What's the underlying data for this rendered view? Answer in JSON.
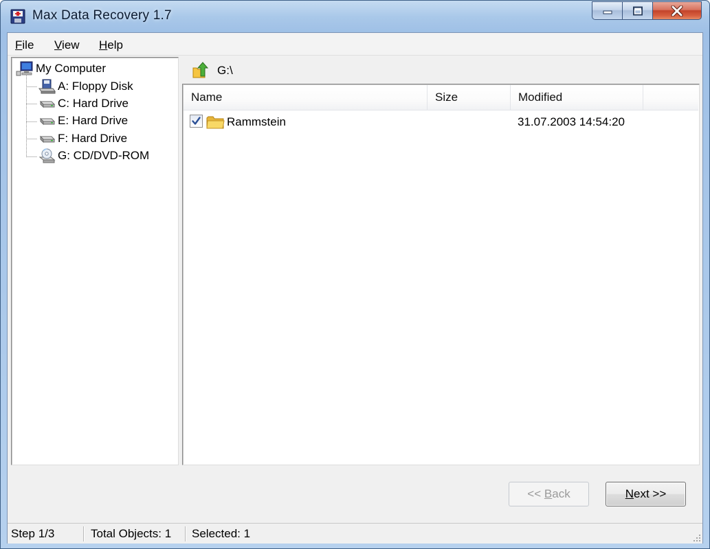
{
  "window": {
    "title": "Max Data Recovery 1.7"
  },
  "menu": {
    "file": {
      "label": "File",
      "accel": "F",
      "rest": "ile"
    },
    "view": {
      "label": "View",
      "accel": "V",
      "rest": "iew"
    },
    "help": {
      "label": "Help",
      "accel": "H",
      "rest": "elp"
    }
  },
  "tree": {
    "root": {
      "label": "My Computer",
      "icon": "computer-icon"
    },
    "items": [
      {
        "label": "A: Floppy Disk",
        "icon": "floppy-drive-icon"
      },
      {
        "label": "C: Hard Drive",
        "icon": "hard-drive-icon"
      },
      {
        "label": "E: Hard Drive",
        "icon": "hard-drive-icon"
      },
      {
        "label": "F: Hard Drive",
        "icon": "hard-drive-icon"
      },
      {
        "label": "G: CD/DVD-ROM",
        "icon": "cd-drive-icon",
        "selected": true
      }
    ]
  },
  "path": {
    "current": "G:\\",
    "up_icon": "folder-up-icon"
  },
  "list": {
    "columns": [
      "Name",
      "Size",
      "Modified"
    ],
    "rows": [
      {
        "name": "Rammstein",
        "size": "",
        "modified": "31.07.2003 14:54:20",
        "checked": true,
        "icon": "folder-icon"
      }
    ]
  },
  "buttons": {
    "back": {
      "pre": "<< ",
      "accel": "B",
      "rest": "ack",
      "enabled": false
    },
    "next": {
      "accel": "N",
      "rest": "ext >>",
      "enabled": true
    }
  },
  "status": {
    "step": "Step 1/3",
    "total": "Total Objects: 1",
    "selected": "Selected: 1"
  },
  "colors": {
    "title_glass": "#a9c8e9",
    "close_button": "#c2432a",
    "checkbox_mark": "#2a4f95",
    "folder_yellow": "#f2c94c"
  }
}
